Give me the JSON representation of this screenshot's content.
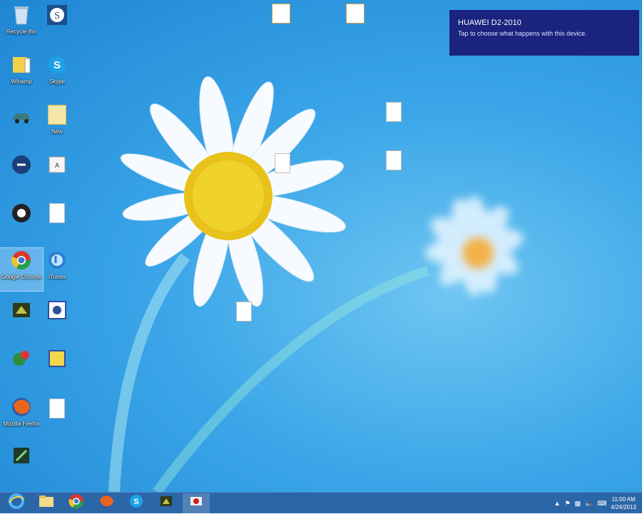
{
  "notification": {
    "title": "HUAWEI D2-2010",
    "message": "Tap to choose what happens with this device."
  },
  "desktop_icons": [
    {
      "label": "Recycle Bin",
      "icon": "recycle-bin-icon"
    },
    {
      "label": "Skype",
      "icon": "skype-icon"
    },
    {
      "label": "Google Chrome",
      "icon": "chrome-icon"
    },
    {
      "label": "Mozilla Firefox",
      "icon": "firefox-icon"
    },
    {
      "label": "Winamp",
      "icon": "winamp-icon"
    },
    {
      "label": "iTunes",
      "icon": "itunes-icon"
    },
    {
      "label": "New",
      "icon": "folder-icon"
    }
  ],
  "taskbar": {
    "apps": [
      "Internet Explorer",
      "File Explorer",
      "Google Chrome",
      "Mozilla Firefox",
      "Skype",
      "Camtasia",
      "Bandicam"
    ]
  },
  "clock": {
    "time": "11:00 AM",
    "date": "4/24/2013"
  },
  "colors": {
    "notification_bg": "#1a237e",
    "taskbar_bg": "#2b66a8"
  }
}
